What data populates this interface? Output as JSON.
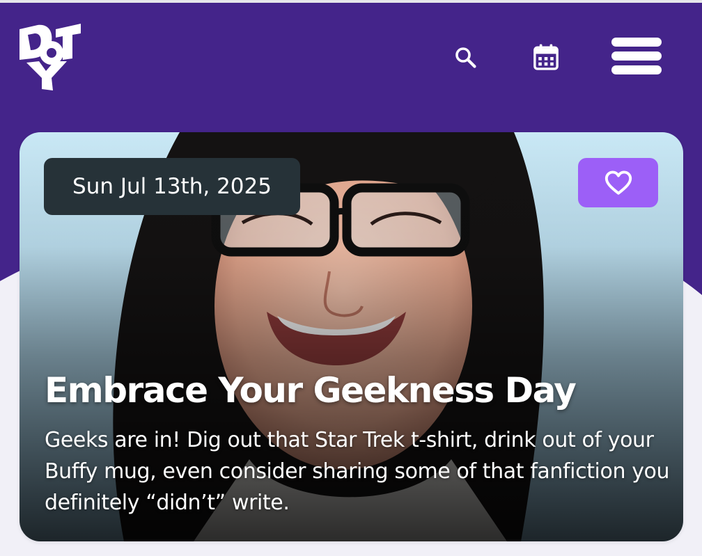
{
  "header": {
    "logo_text": "DOTY",
    "search_icon": "search-icon",
    "calendar_icon": "calendar-icon",
    "menu_icon": "hamburger-menu-icon",
    "background_color": "#44248a"
  },
  "card": {
    "date": "Sun Jul 13th, 2025",
    "favorite_icon": "heart-outline-icon",
    "title": "Embrace Your Geekness Day",
    "description": "Geeks are in! Dig out that Star Trek t-shirt, drink out of your Buffy mug, even consider sharing some of that fanfiction you definitely “didn’t” write.",
    "date_pill_color": "#263238",
    "favorite_button_color": "#9c5ff7"
  }
}
